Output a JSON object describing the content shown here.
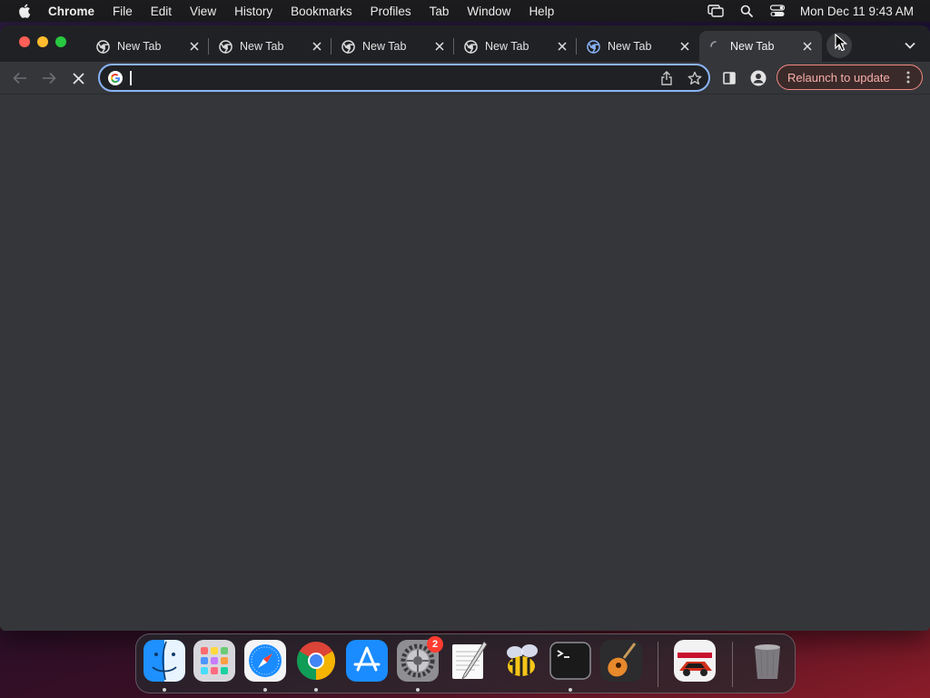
{
  "menubar": {
    "app_name": "Chrome",
    "items": [
      "File",
      "Edit",
      "View",
      "History",
      "Bookmarks",
      "Profiles",
      "Tab",
      "Window",
      "Help"
    ],
    "clock": "Mon Dec 11  9:43 AM"
  },
  "tabs": [
    {
      "title": "New Tab",
      "active": false
    },
    {
      "title": "New Tab",
      "active": false
    },
    {
      "title": "New Tab",
      "active": false
    },
    {
      "title": "New Tab",
      "active": false
    },
    {
      "title": "New Tab",
      "active": false
    },
    {
      "title": "New Tab",
      "active": true
    }
  ],
  "omnibox": {
    "value": "",
    "placeholder": ""
  },
  "toolbar": {
    "relaunch_label": "Relaunch to update"
  },
  "dock": {
    "apps": [
      "Finder",
      "Launchpad",
      "Safari",
      "Google Chrome",
      "App Store",
      "System Settings",
      "TextEdit",
      "Bee",
      "Terminal",
      "GarageBand",
      "Asphalt",
      "Trash"
    ],
    "system_settings_badge": "2"
  },
  "colors": {
    "accent": "#8ab4f8",
    "relaunch": "#f28b82",
    "tabstrip": "#202124",
    "window": "#35363a"
  }
}
